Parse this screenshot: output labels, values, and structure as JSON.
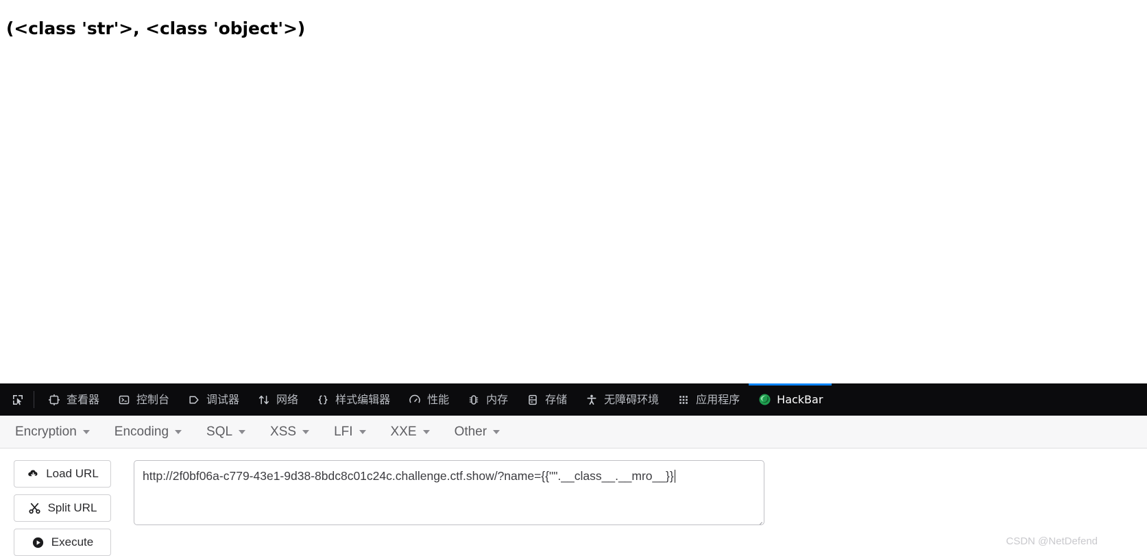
{
  "page": {
    "content_text": "(<class 'str'>, <class 'object'>)"
  },
  "devtools": {
    "picker_icon": "element-picker-icon",
    "tabs": [
      {
        "label": "查看器",
        "icon": "inspector-icon",
        "active": false
      },
      {
        "label": "控制台",
        "icon": "console-icon",
        "active": false
      },
      {
        "label": "调试器",
        "icon": "debugger-icon",
        "active": false
      },
      {
        "label": "网络",
        "icon": "network-icon",
        "active": false
      },
      {
        "label": "样式编辑器",
        "icon": "style-editor-icon",
        "active": false
      },
      {
        "label": "性能",
        "icon": "performance-icon",
        "active": false
      },
      {
        "label": "内存",
        "icon": "memory-icon",
        "active": false
      },
      {
        "label": "存储",
        "icon": "storage-icon",
        "active": false
      },
      {
        "label": "无障碍环境",
        "icon": "accessibility-icon",
        "active": false
      },
      {
        "label": "应用程序",
        "icon": "application-icon",
        "active": false
      },
      {
        "label": "HackBar",
        "icon": "hackbar-firefox-icon",
        "active": true
      }
    ],
    "active_tab_accent": "#0a84ff",
    "background": "#0b0b0d"
  },
  "hackbar": {
    "menus": [
      {
        "label": "Encryption"
      },
      {
        "label": "Encoding"
      },
      {
        "label": "SQL"
      },
      {
        "label": "XSS"
      },
      {
        "label": "LFI"
      },
      {
        "label": "XXE"
      },
      {
        "label": "Other"
      }
    ],
    "buttons": [
      {
        "label": "Load URL",
        "icon": "cloud-download-icon"
      },
      {
        "label": "Split URL",
        "icon": "scissors-icon"
      },
      {
        "label": "Execute",
        "icon": "play-circle-icon"
      }
    ],
    "url_field": {
      "value": "http://2f0bf06a-c779-43e1-9d38-8bdc8c01c24c.challenge.ctf.show/?name={{\"\".__class__.__mro__}}",
      "placeholder": ""
    }
  },
  "watermark": {
    "text": "CSDN @NetDefend"
  }
}
